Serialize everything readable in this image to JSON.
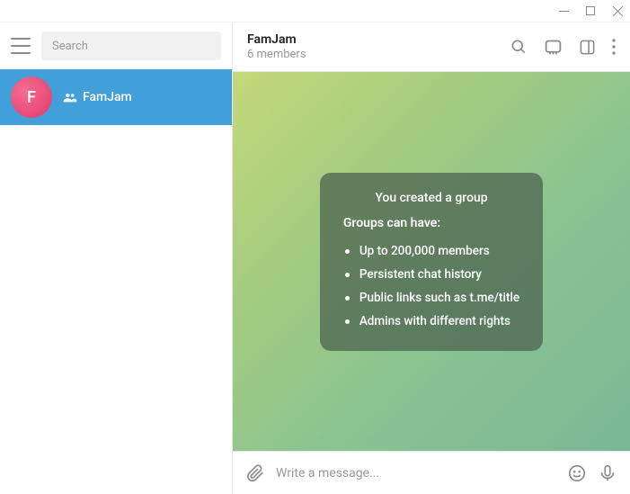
{
  "search": {
    "placeholder": "Search"
  },
  "chat": {
    "avatar_letter": "F",
    "name": "FamJam"
  },
  "header": {
    "title": "FamJam",
    "subtitle": "6 members"
  },
  "info": {
    "title": "You created a group",
    "subtitle": "Groups can have:",
    "items": [
      "Up to 200,000 members",
      "Persistent chat history",
      "Public links such as t.me/title",
      "Admins with different rights"
    ]
  },
  "composer": {
    "placeholder": "Write a message..."
  }
}
